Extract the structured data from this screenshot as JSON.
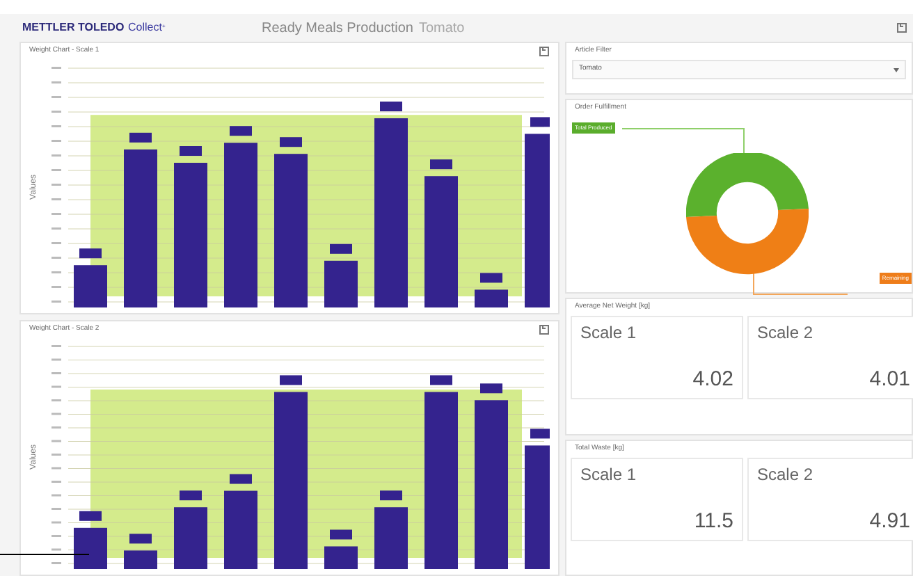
{
  "header": {
    "brand": "METTLER TOLEDO",
    "product": "Collect",
    "product_mark": "+",
    "title": "Ready Meals Production",
    "subtitle": "Tomato"
  },
  "charts": [
    {
      "title": "Weight Chart - Scale 1",
      "axis_label": "Values"
    },
    {
      "title": "Weight Chart - Scale 2",
      "axis_label": "Values"
    }
  ],
  "article_filter": {
    "title": "Article Filter",
    "value": "Tomato"
  },
  "order_fulfillment": {
    "title": "Order Fulfillment",
    "label_produced": "Total Produced",
    "label_remaining": "Remaining"
  },
  "tiles": [
    {
      "title": "Average Net Weight [kg]",
      "cards": [
        {
          "label": "Scale 1",
          "value": "4.02"
        },
        {
          "label": "Scale 2",
          "value": "4.01"
        }
      ]
    },
    {
      "title": "Total Waste [kg]",
      "cards": [
        {
          "label": "Scale 1",
          "value": "11.5"
        },
        {
          "label": "Scale 2",
          "value": "4.91"
        }
      ]
    }
  ]
}
